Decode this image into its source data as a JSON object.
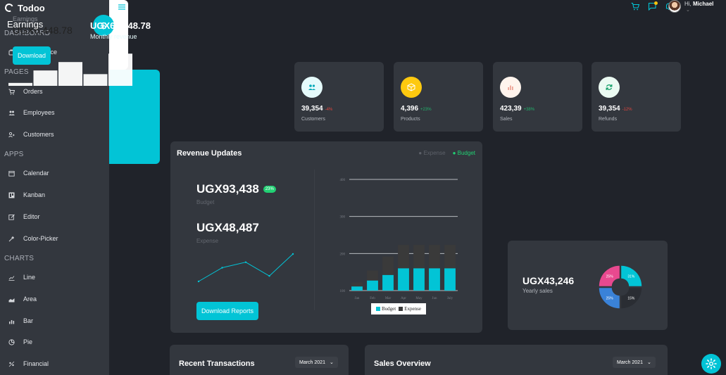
{
  "brand": {
    "name": "Todoo"
  },
  "sidebar": {
    "sections": [
      {
        "title": "DASHBOARD",
        "items": [
          {
            "label": "Ecommerce",
            "icon": "bag-icon"
          }
        ]
      },
      {
        "title": "PAGES",
        "items": [
          {
            "label": "Orders",
            "icon": "cart-icon"
          },
          {
            "label": "Employees",
            "icon": "people-icon"
          },
          {
            "label": "Customers",
            "icon": "customers-icon"
          }
        ]
      },
      {
        "title": "APPS",
        "items": [
          {
            "label": "Calendar",
            "icon": "calendar-icon"
          },
          {
            "label": "Kanban",
            "icon": "kanban-icon"
          },
          {
            "label": "Editor",
            "icon": "edit-icon"
          },
          {
            "label": "Color-Picker",
            "icon": "color-picker-icon"
          }
        ]
      },
      {
        "title": "CHARTS",
        "items": [
          {
            "label": "Line",
            "icon": "line-chart-icon"
          },
          {
            "label": "Area",
            "icon": "area-chart-icon"
          },
          {
            "label": "Bar",
            "icon": "bar-chart-icon"
          },
          {
            "label": "Pie",
            "icon": "pie-chart-icon"
          },
          {
            "label": "Financial",
            "icon": "financial-icon"
          }
        ]
      }
    ]
  },
  "topbar": {
    "greeting": "Hi,",
    "user": "Michael"
  },
  "earnings_card": {
    "label": "Earnings",
    "value": "UGX6,448.78",
    "button": "Download"
  },
  "stats": [
    {
      "value": "39,354",
      "pct": "-4%",
      "trend": "neg",
      "label": "Customers",
      "icon": "customers-icon",
      "bg": "#e5fafb",
      "fg": "#02a8b8"
    },
    {
      "value": "4,396",
      "pct": "+23%",
      "trend": "pos",
      "label": "Products",
      "icon": "box-icon",
      "bg": "#fec90f",
      "fg": "#ffffff"
    },
    {
      "value": "423,39",
      "pct": "+38%",
      "trend": "pos",
      "label": "Sales",
      "icon": "bar-chart-icon",
      "bg": "#fff4ed",
      "fg": "#e47b6a"
    },
    {
      "value": "39,354",
      "pct": "-12%",
      "trend": "neg",
      "label": "Refunds",
      "icon": "refresh-icon",
      "bg": "#ebfaf2",
      "fg": "#16a06a"
    }
  ],
  "revenue": {
    "title": "Revenue Updates",
    "legend_expense": "Expense",
    "legend_budget": "Budget",
    "budget_value": "UGX93,438",
    "budget_badge": "23%",
    "budget_label": "Budget",
    "expense_value": "UGX48,487",
    "expense_label": "Expense",
    "download": "Download Reports"
  },
  "chart_data": {
    "type": "bar",
    "stacked": true,
    "categories": [
      "Jan",
      "Feb",
      "Mar",
      "Apr",
      "May",
      "Jun",
      "July"
    ],
    "series": [
      {
        "name": "Budget",
        "values": [
          111,
          127,
          142,
          160,
          160,
          160,
          160
        ],
        "color": "#02c4d6"
      },
      {
        "name": "Expense",
        "values": [
          111,
          127,
          150,
          163,
          163,
          163,
          163
        ],
        "color": "#3a3a3a"
      }
    ],
    "yticks": [
      100,
      200,
      300,
      400
    ],
    "ylim": [
      100,
      400
    ],
    "sparkline": [
      10,
      35,
      45,
      20,
      60
    ]
  },
  "earnings_teal": {
    "label": "Earnings",
    "value": "UGX63,448.78",
    "sub": "Monthly revenue",
    "bars": [
      0.08,
      0.42,
      0.65,
      0.32,
      0.88
    ]
  },
  "yearly": {
    "value": "UGX43,246",
    "label": "Yearly sales",
    "segments": [
      {
        "label": "31%",
        "color": "#02c4d6"
      },
      {
        "label": "15%",
        "color": "#2a2d33"
      },
      {
        "label": "25%",
        "color": "#3a82d8"
      },
      {
        "label": "25%",
        "color": "#e8498f"
      }
    ]
  },
  "recent": {
    "title": "Recent Transactions",
    "month": "March 2021"
  },
  "sales_overview": {
    "title": "Sales Overview",
    "month": "March 2021"
  }
}
